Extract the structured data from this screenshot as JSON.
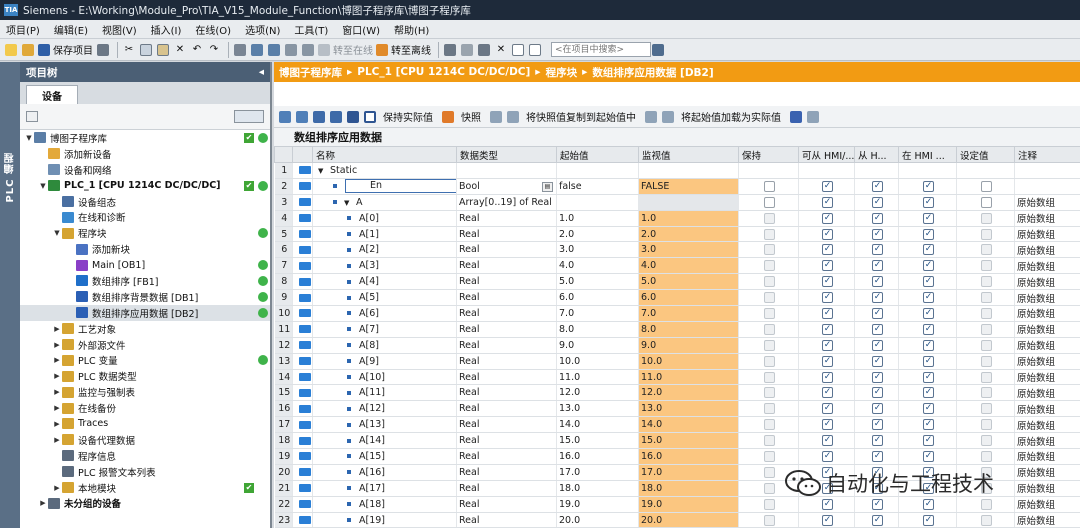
{
  "window": {
    "title": "Siemens  -  E:\\Working\\Module_Pro\\TIA_V15_Module_Function\\博图子程序库\\博图子程序库",
    "logo": "TIA"
  },
  "menu": [
    "项目(P)",
    "编辑(E)",
    "视图(V)",
    "插入(I)",
    "在线(O)",
    "选项(N)",
    "工具(T)",
    "窗口(W)",
    "帮助(H)"
  ],
  "toolbar": {
    "save_project": "保存项目",
    "go_online": "转至在线",
    "go_offline": "转至离线",
    "search_placeholder": "<在项目中搜索>"
  },
  "left_tab": "PLC 编程",
  "project_tree": {
    "title": "项目树",
    "tab": "设备",
    "items": [
      {
        "label": "博图子程序库",
        "level": 0,
        "toggle": "▼",
        "icon": "#5b7ea6",
        "check": true,
        "dot": true
      },
      {
        "label": "添加新设备",
        "level": 1,
        "toggle": "",
        "icon": "#e3a93a"
      },
      {
        "label": "设备和网络",
        "level": 1,
        "toggle": "",
        "icon": "#6f8fb3"
      },
      {
        "label": "PLC_1 [CPU 1214C DC/DC/DC]",
        "level": 1,
        "toggle": "▼",
        "icon": "#2e8a3c",
        "check": true,
        "dot": true,
        "bold": true
      },
      {
        "label": "设备组态",
        "level": 2,
        "toggle": "",
        "icon": "#4a6fa1"
      },
      {
        "label": "在线和诊断",
        "level": 2,
        "toggle": "",
        "icon": "#3a8ad0"
      },
      {
        "label": "程序块",
        "level": 2,
        "toggle": "▼",
        "icon": "#d5a432",
        "dot": true
      },
      {
        "label": "添加新块",
        "level": 3,
        "toggle": "",
        "icon": "#4a72c2"
      },
      {
        "label": "Main [OB1]",
        "level": 3,
        "toggle": "",
        "icon": "#8a3fc7",
        "dot": true
      },
      {
        "label": "数组排序 [FB1]",
        "level": 3,
        "toggle": "",
        "icon": "#1f6fc9",
        "dot": true
      },
      {
        "label": "数组排序背景数据 [DB1]",
        "level": 3,
        "toggle": "",
        "icon": "#2b5fb5",
        "dot": true
      },
      {
        "label": "数组排序应用数据 [DB2]",
        "level": 3,
        "toggle": "",
        "icon": "#2b5fb5",
        "dot": true,
        "selected": true
      },
      {
        "label": "工艺对象",
        "level": 2,
        "toggle": "▶",
        "icon": "#d5a432"
      },
      {
        "label": "外部源文件",
        "level": 2,
        "toggle": "▶",
        "icon": "#d5a432"
      },
      {
        "label": "PLC 变量",
        "level": 2,
        "toggle": "▶",
        "icon": "#d5a432",
        "dot": true
      },
      {
        "label": "PLC 数据类型",
        "level": 2,
        "toggle": "▶",
        "icon": "#d5a432"
      },
      {
        "label": "监控与强制表",
        "level": 2,
        "toggle": "▶",
        "icon": "#d5a432"
      },
      {
        "label": "在线备份",
        "level": 2,
        "toggle": "▶",
        "icon": "#d5a432"
      },
      {
        "label": "Traces",
        "level": 2,
        "toggle": "▶",
        "icon": "#d5a432"
      },
      {
        "label": "设备代理数据",
        "level": 2,
        "toggle": "▶",
        "icon": "#d5a432"
      },
      {
        "label": "程序信息",
        "level": 2,
        "toggle": "",
        "icon": "#5b6a7d"
      },
      {
        "label": "PLC 报警文本列表",
        "level": 2,
        "toggle": "",
        "icon": "#5b6a7d"
      },
      {
        "label": "本地模块",
        "level": 2,
        "toggle": "▶",
        "icon": "#d5a432",
        "check": true
      },
      {
        "label": "未分组的设备",
        "level": 1,
        "toggle": "▶",
        "icon": "#5b6a7d",
        "bold": true
      }
    ]
  },
  "breadcrumb": [
    "博图子程序库",
    "PLC_1 [CPU 1214C DC/DC/DC]",
    "程序块",
    "数组排序应用数据 [DB2]"
  ],
  "editor_toolbar": {
    "keep_actual": "保持实际值",
    "snapshot": "快照",
    "copy_snapshot": "将快照值复制到起始值中",
    "load_start": "将起始值加载为实际值"
  },
  "db_title": "数组排序应用数据",
  "columns": [
    "名称",
    "数据类型",
    "起始值",
    "监视值",
    "保持",
    "可从 HMI/...",
    "从 H...",
    "在 HMI ...",
    "设定值",
    "注释"
  ],
  "rows": [
    {
      "no": "1",
      "name": "Static",
      "indent": 0,
      "expand": "▼",
      "type": "",
      "start": "",
      "monitor": "",
      "cbs": false,
      "comment": ""
    },
    {
      "no": "2",
      "name": "En",
      "indent": 1,
      "expand": "",
      "type": "Bool",
      "start": "false",
      "monitor": "FALSE",
      "cbs": true,
      "comment": "",
      "editing": true
    },
    {
      "no": "3",
      "name": "A",
      "indent": 1,
      "expand": "▼",
      "type": "Array[0..19] of Real",
      "start": "",
      "monitor": "",
      "cbs": true,
      "comment": "原始数组"
    },
    {
      "no": "4",
      "name": "A[0]",
      "indent": 2,
      "type": "Real",
      "start": "1.0",
      "monitor": "1.0",
      "comment": "原始数组"
    },
    {
      "no": "5",
      "name": "A[1]",
      "indent": 2,
      "type": "Real",
      "start": "2.0",
      "monitor": "2.0",
      "comment": "原始数组"
    },
    {
      "no": "6",
      "name": "A[2]",
      "indent": 2,
      "type": "Real",
      "start": "3.0",
      "monitor": "3.0",
      "comment": "原始数组"
    },
    {
      "no": "7",
      "name": "A[3]",
      "indent": 2,
      "type": "Real",
      "start": "4.0",
      "monitor": "4.0",
      "comment": "原始数组"
    },
    {
      "no": "8",
      "name": "A[4]",
      "indent": 2,
      "type": "Real",
      "start": "5.0",
      "monitor": "5.0",
      "comment": "原始数组"
    },
    {
      "no": "9",
      "name": "A[5]",
      "indent": 2,
      "type": "Real",
      "start": "6.0",
      "monitor": "6.0",
      "comment": "原始数组"
    },
    {
      "no": "10",
      "name": "A[6]",
      "indent": 2,
      "type": "Real",
      "start": "7.0",
      "monitor": "7.0",
      "comment": "原始数组"
    },
    {
      "no": "11",
      "name": "A[7]",
      "indent": 2,
      "type": "Real",
      "start": "8.0",
      "monitor": "8.0",
      "comment": "原始数组"
    },
    {
      "no": "12",
      "name": "A[8]",
      "indent": 2,
      "type": "Real",
      "start": "9.0",
      "monitor": "9.0",
      "comment": "原始数组"
    },
    {
      "no": "13",
      "name": "A[9]",
      "indent": 2,
      "type": "Real",
      "start": "10.0",
      "monitor": "10.0",
      "comment": "原始数组"
    },
    {
      "no": "14",
      "name": "A[10]",
      "indent": 2,
      "type": "Real",
      "start": "11.0",
      "monitor": "11.0",
      "comment": "原始数组"
    },
    {
      "no": "15",
      "name": "A[11]",
      "indent": 2,
      "type": "Real",
      "start": "12.0",
      "monitor": "12.0",
      "comment": "原始数组"
    },
    {
      "no": "16",
      "name": "A[12]",
      "indent": 2,
      "type": "Real",
      "start": "13.0",
      "monitor": "13.0",
      "comment": "原始数组"
    },
    {
      "no": "17",
      "name": "A[13]",
      "indent": 2,
      "type": "Real",
      "start": "14.0",
      "monitor": "14.0",
      "comment": "原始数组"
    },
    {
      "no": "18",
      "name": "A[14]",
      "indent": 2,
      "type": "Real",
      "start": "15.0",
      "monitor": "15.0",
      "comment": "原始数组"
    },
    {
      "no": "19",
      "name": "A[15]",
      "indent": 2,
      "type": "Real",
      "start": "16.0",
      "monitor": "16.0",
      "comment": "原始数组"
    },
    {
      "no": "20",
      "name": "A[16]",
      "indent": 2,
      "type": "Real",
      "start": "17.0",
      "monitor": "17.0",
      "comment": "原始数组"
    },
    {
      "no": "21",
      "name": "A[17]",
      "indent": 2,
      "type": "Real",
      "start": "18.0",
      "monitor": "18.0",
      "comment": "原始数组"
    },
    {
      "no": "22",
      "name": "A[18]",
      "indent": 2,
      "type": "Real",
      "start": "19.0",
      "monitor": "19.0",
      "comment": "原始数组"
    },
    {
      "no": "23",
      "name": "A[19]",
      "indent": 2,
      "type": "Real",
      "start": "20.0",
      "monitor": "20.0",
      "comment": "原始数组"
    }
  ],
  "watermark": "自动化与工程技术",
  "colors": {
    "accent_orange": "#f29b13",
    "monitor_bg": "#fbc680",
    "status_green": "#3fb34a",
    "title_bar": "#1e2a3a",
    "header_blue": "#4b5f75"
  }
}
